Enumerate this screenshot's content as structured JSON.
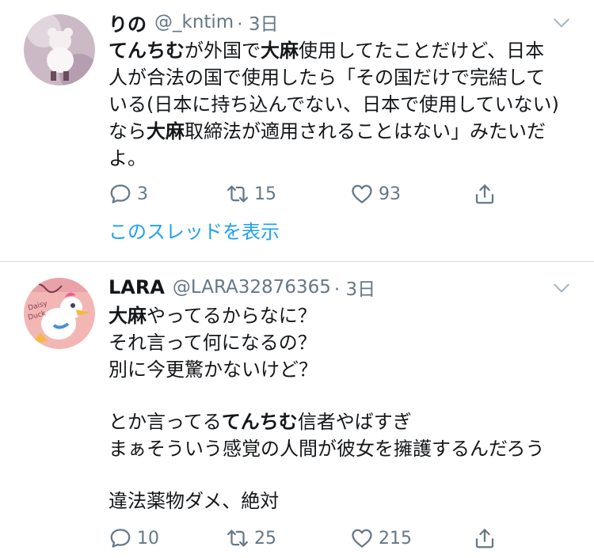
{
  "tweets": [
    {
      "name": "りの",
      "handle": "@_kntim",
      "time": "· 3日",
      "lines": [
        [
          {
            "t": "てんちむ",
            "b": true
          },
          {
            "t": "が外国で",
            "b": false
          },
          {
            "t": "大麻",
            "b": true
          },
          {
            "t": "使用してたことだけど、日本",
            "b": false
          }
        ],
        [
          {
            "t": "人が合法の国で使用したら「その国だけで完結して",
            "b": false
          }
        ],
        [
          {
            "t": "いる(日本に持ち込んでない、日本で使用していない)",
            "b": false
          }
        ],
        [
          {
            "t": "なら",
            "b": false
          },
          {
            "t": "大麻",
            "b": true
          },
          {
            "t": "取締法が適用されることはない」みたいだ",
            "b": false
          }
        ],
        [
          {
            "t": "よ。",
            "b": false
          }
        ]
      ],
      "replies": "3",
      "retweets": "15",
      "likes": "93",
      "thread_link": "このスレッドを表示"
    },
    {
      "name": "LARA",
      "handle": "@LARA32876365",
      "time": "· 3日",
      "lines": [
        [
          {
            "t": "大麻",
            "b": true
          },
          {
            "t": "やってるからなに？",
            "b": false
          }
        ],
        [
          {
            "t": "それ言って何になるの？",
            "b": false
          }
        ],
        [
          {
            "t": "別に今更驚かないけど？",
            "b": false
          }
        ],
        [],
        [
          {
            "t": "とか言ってる",
            "b": false
          },
          {
            "t": "てんちむ",
            "b": true
          },
          {
            "t": "信者やばすぎ",
            "b": false
          }
        ],
        [
          {
            "t": "まぁそういう感覚の人間が彼女を擁護するんだろう",
            "b": false
          }
        ],
        [],
        [
          {
            "t": "違法薬物ダメ、絶対",
            "b": false
          }
        ]
      ],
      "replies": "10",
      "retweets": "25",
      "likes": "215"
    }
  ],
  "colors": {
    "text": "#14171a",
    "secondary": "#657786",
    "link": "#1da1f2",
    "divider": "#d9dde1"
  },
  "icons": {
    "reply": "reply-icon",
    "retweet": "retweet-icon",
    "like": "heart-icon",
    "share": "share-icon",
    "menu": "chevron-down-icon"
  }
}
